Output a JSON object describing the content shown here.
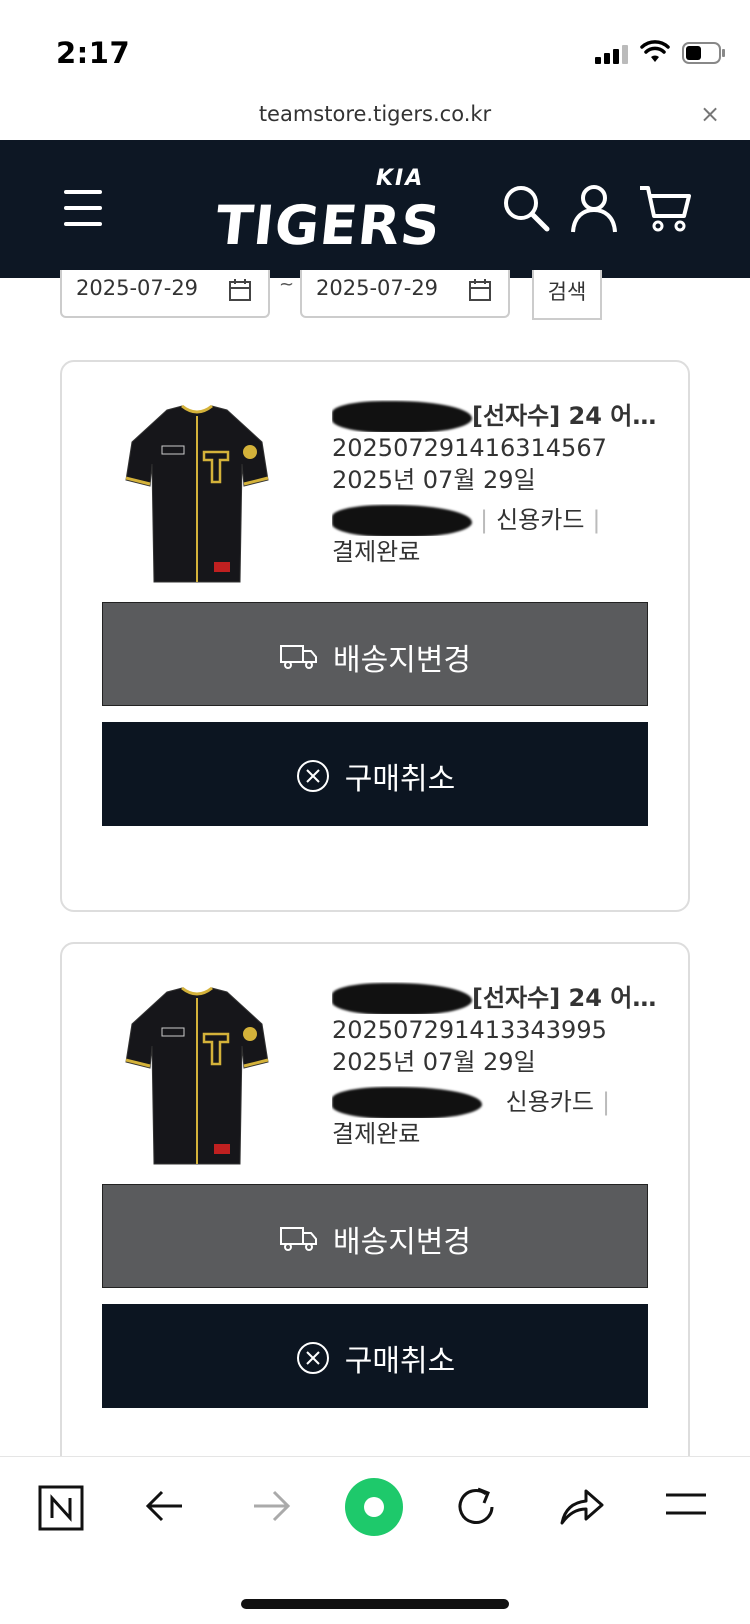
{
  "status": {
    "time": "2:17"
  },
  "browser": {
    "url": "teamstore.tigers.co.kr",
    "close_label": "×"
  },
  "header": {
    "brand_small": "KIA",
    "brand": "TIGERS"
  },
  "search": {
    "date_from": "2025-07-29",
    "date_to": "2025-07-29",
    "tilde": "~",
    "button_label": "검색"
  },
  "orders": [
    {
      "product_name": "[선자수] 24 어…",
      "order_number": "202507291416314567",
      "order_date": "2025년 07월 29일",
      "payment_method": "신용카드",
      "status": "결제완료",
      "change_address_label": "배송지변경",
      "cancel_label": "구매취소"
    },
    {
      "product_name": "[선자수] 24 어…",
      "order_number": "202507291413343995",
      "order_date": "2025년 07월 29일",
      "payment_method": "신용카드",
      "status": "결제완료",
      "change_address_label": "배송지변경",
      "cancel_label": "구매취소"
    }
  ],
  "colors": {
    "header_bg": "#0d1724",
    "gray_button": "#5a5b5d",
    "dark_button": "#0c1521",
    "accent_green": "#1ec96b"
  }
}
